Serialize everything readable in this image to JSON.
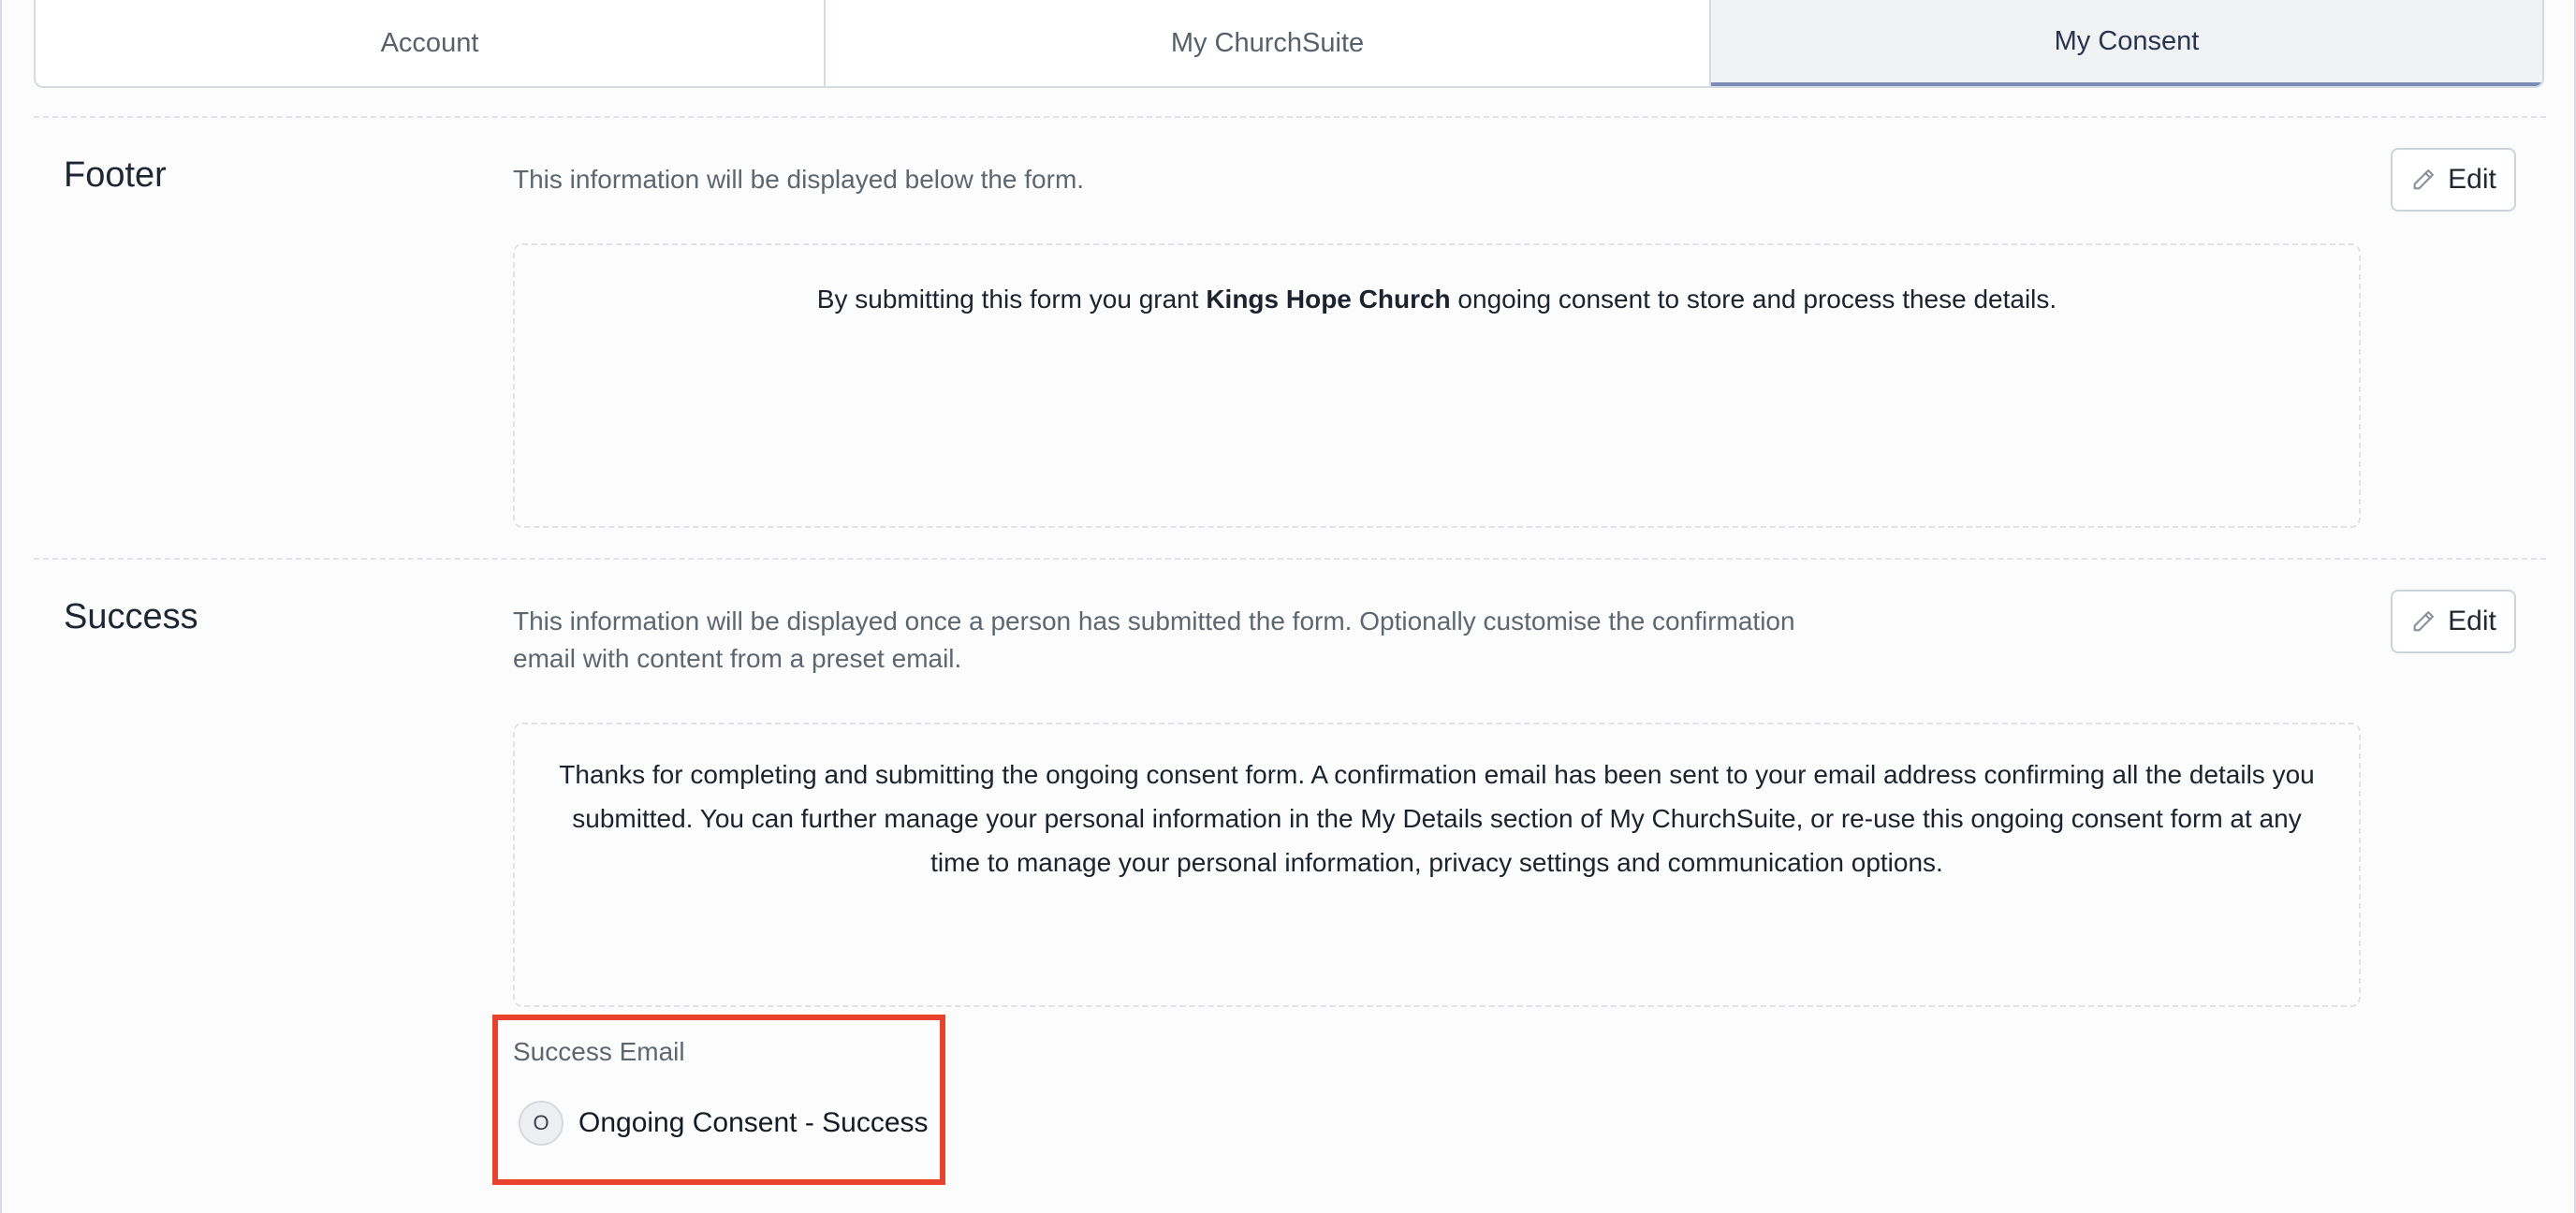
{
  "tabs": [
    {
      "label": "Account",
      "active": false
    },
    {
      "label": "My ChurchSuite",
      "active": false
    },
    {
      "label": "My Consent",
      "active": true
    }
  ],
  "footer": {
    "title": "Footer",
    "description": "This information will be displayed below the form.",
    "edit_label": "Edit",
    "content_prefix": "By submitting this form you grant ",
    "content_bold": "Kings Hope Church",
    "content_suffix": " ongoing consent to store and process these details."
  },
  "success": {
    "title": "Success",
    "description_line1": "This information will be displayed once a person has submitted the form. Optionally customise the confirmation",
    "description_line2": "email with content from a preset email.",
    "edit_label": "Edit",
    "content_line1": "Thanks for completing and submitting the ongoing consent form. A confirmation email has been sent to your email address confirming all the details you",
    "content_line2": "submitted. You can further manage your personal information in the My Details section of My ChurchSuite, or re-use this ongoing consent form at any",
    "content_line3": "time to manage your personal information, privacy settings and communication options.",
    "email_label": "Success Email",
    "email_avatar": "O",
    "email_name": "Ongoing Consent - Success"
  },
  "colors": {
    "highlight": "#e8432e",
    "active_tab_underline": "#7b8cb7"
  },
  "icons": {
    "edit": "pencil-icon"
  }
}
